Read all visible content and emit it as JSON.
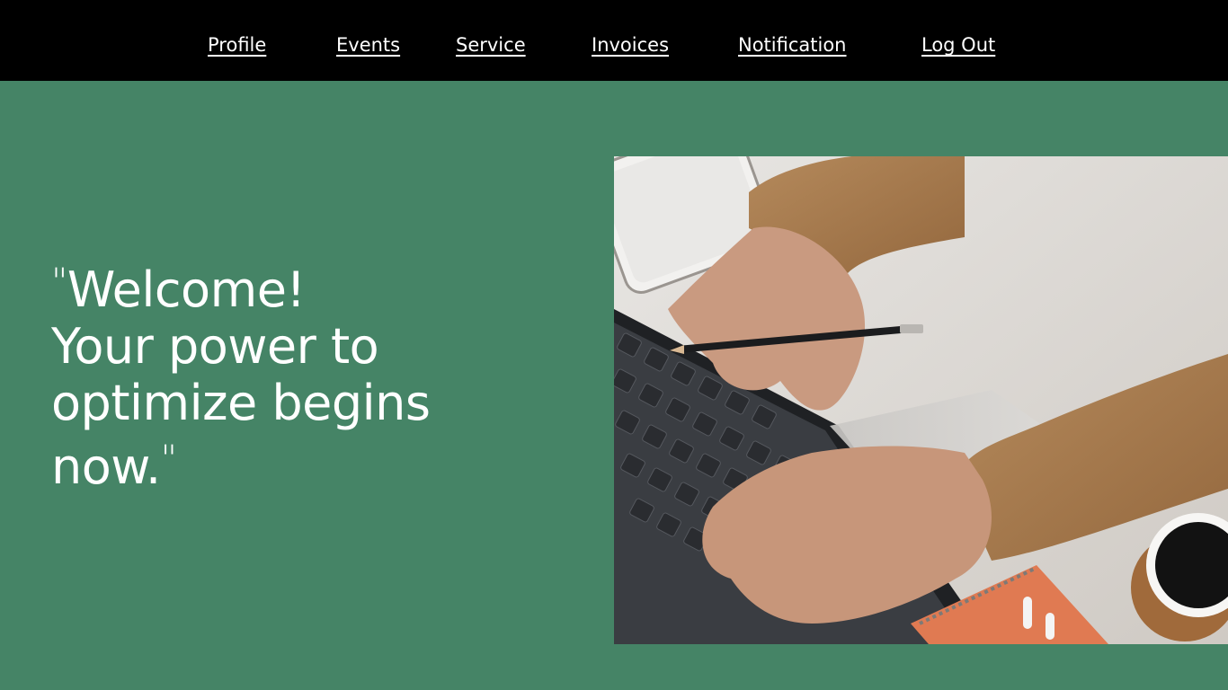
{
  "nav": {
    "items": [
      {
        "key": "profile",
        "label": "Profile"
      },
      {
        "key": "events",
        "label": "Events"
      },
      {
        "key": "service",
        "label": "Service"
      },
      {
        "key": "invoices",
        "label": "Invoices"
      },
      {
        "key": "notification",
        "label": "Notification"
      },
      {
        "key": "logout",
        "label": "Log Out"
      }
    ]
  },
  "hero": {
    "open_quote": "\"",
    "line1": "Welcome!",
    "line2": "Your power to",
    "line3": "optimize begins",
    "line4": "now.",
    "close_quote": "\""
  },
  "theme": {
    "background": "#458466",
    "nav_background": "#000000",
    "text": "#ffffff"
  },
  "image": {
    "icon": "laptop-typing-photo"
  }
}
